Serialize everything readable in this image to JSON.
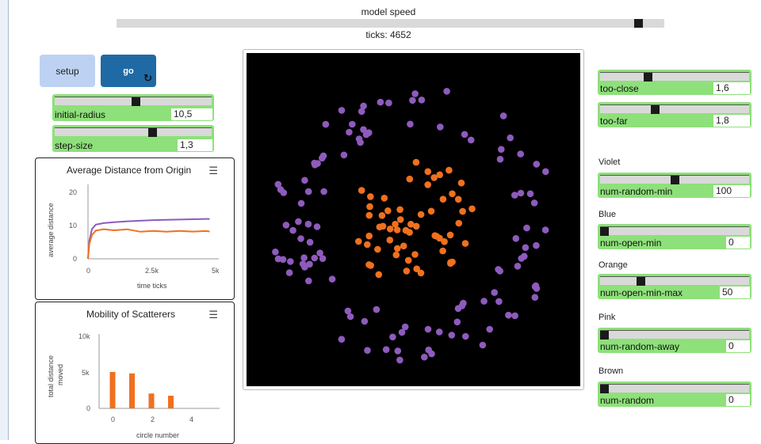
{
  "model_speed": {
    "label": "model speed",
    "value": 0.96
  },
  "ticks_text": "ticks: 4652",
  "buttons": {
    "setup": "setup",
    "go": "go"
  },
  "sliders_left": [
    {
      "id": "initial-radius",
      "label": "initial-radius",
      "value": "10,5",
      "pos": 0.52
    },
    {
      "id": "step-size",
      "label": "step-size",
      "value": "1,3",
      "pos": 0.63
    }
  ],
  "plot1": {
    "title": "Average Distance from Origin",
    "ylabel": "average distance",
    "xlabel": "time ticks",
    "yticks": [
      "20",
      "10",
      "0"
    ],
    "xticks": [
      "0",
      "2.5k",
      "5k"
    ]
  },
  "plot2": {
    "title": "Mobility of Scatterers",
    "ylabel1": "total distance",
    "ylabel2": "moved",
    "xlabel": "circle number",
    "yticks": [
      "10k",
      "5k",
      "0"
    ],
    "xticks": [
      "0",
      "2",
      "4"
    ]
  },
  "sliders_right_top": [
    {
      "id": "too-close",
      "label": "too-close",
      "value": "1,6",
      "pos": 0.31
    },
    {
      "id": "too-far",
      "label": "too-far",
      "value": "1,8",
      "pos": 0.36
    }
  ],
  "groups": [
    {
      "name": "Violet",
      "slider": {
        "label": "num-random-min",
        "value": "100",
        "pos": 0.5
      }
    },
    {
      "name": "Blue",
      "slider": {
        "label": "num-open-min",
        "value": "0",
        "pos": 0.0
      }
    },
    {
      "name": "Orange",
      "slider": {
        "label": "num-open-min-max",
        "value": "50",
        "pos": 0.26
      }
    },
    {
      "name": "Pink",
      "slider": {
        "label": "num-random-away",
        "value": "0",
        "pos": 0.0
      }
    },
    {
      "name": "Brown",
      "slider": {
        "label": "num-random",
        "value": "0",
        "pos": 0.0
      }
    }
  ],
  "colors": {
    "violet": "#8e5bbd",
    "orange": "#f0701e",
    "slider_green": "#8ee07a",
    "go_blue": "#1f6aa5",
    "setup_blue": "#bdd2f2"
  },
  "chart_data": [
    {
      "type": "line",
      "title": "Average Distance from Origin",
      "xlabel": "time ticks",
      "ylabel": "average distance",
      "xlim": [
        0,
        5000
      ],
      "ylim": [
        0,
        25
      ],
      "series": [
        {
          "color": "#8e5bbd",
          "x": [
            0,
            50,
            150,
            300,
            600,
            1000,
            1500,
            2000,
            2500,
            3000,
            3500,
            4000,
            4500,
            4652
          ],
          "y": [
            0,
            6,
            10,
            11.5,
            12,
            12.3,
            12.6,
            12.8,
            13,
            13.1,
            13.2,
            13.3,
            13.4,
            13.4
          ]
        },
        {
          "color": "#f0701e",
          "x": [
            0,
            50,
            150,
            300,
            600,
            1000,
            1500,
            2000,
            2500,
            3000,
            3500,
            4000,
            4500,
            4652
          ],
          "y": [
            0,
            5,
            8,
            9.5,
            10,
            9.5,
            10,
            9,
            9.5,
            9,
            9.5,
            9,
            9.5,
            9
          ]
        }
      ]
    },
    {
      "type": "bar",
      "title": "Mobility of Scatterers",
      "xlabel": "circle number",
      "ylabel": "total distance moved",
      "categories": [
        0,
        1,
        2,
        3
      ],
      "values": [
        4900,
        4700,
        2000,
        1700
      ],
      "ylim": [
        0,
        10000
      ]
    }
  ]
}
